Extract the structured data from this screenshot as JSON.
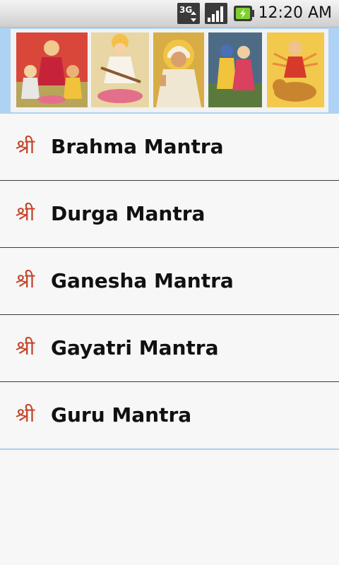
{
  "status_bar": {
    "network_icon": "3g-icon",
    "signal_icon": "signal-icon",
    "battery_icon": "battery-charging-icon",
    "time": "12:20 AM"
  },
  "banner": {
    "images": [
      "lakshmi-ganesh-saraswati-image",
      "saraswati-image",
      "sai-baba-image",
      "radha-krishna-image",
      "durga-image"
    ]
  },
  "list": {
    "bullet": "श्री",
    "items": [
      {
        "label": "Brahma Mantra"
      },
      {
        "label": "Durga Mantra"
      },
      {
        "label": "Ganesha Mantra"
      },
      {
        "label": "Gayatri Mantra"
      },
      {
        "label": "Guru Mantra"
      }
    ]
  },
  "colors": {
    "accent": "#a9cff2",
    "bullet": "#c4452a",
    "banner_bg": "#aed2f3"
  }
}
